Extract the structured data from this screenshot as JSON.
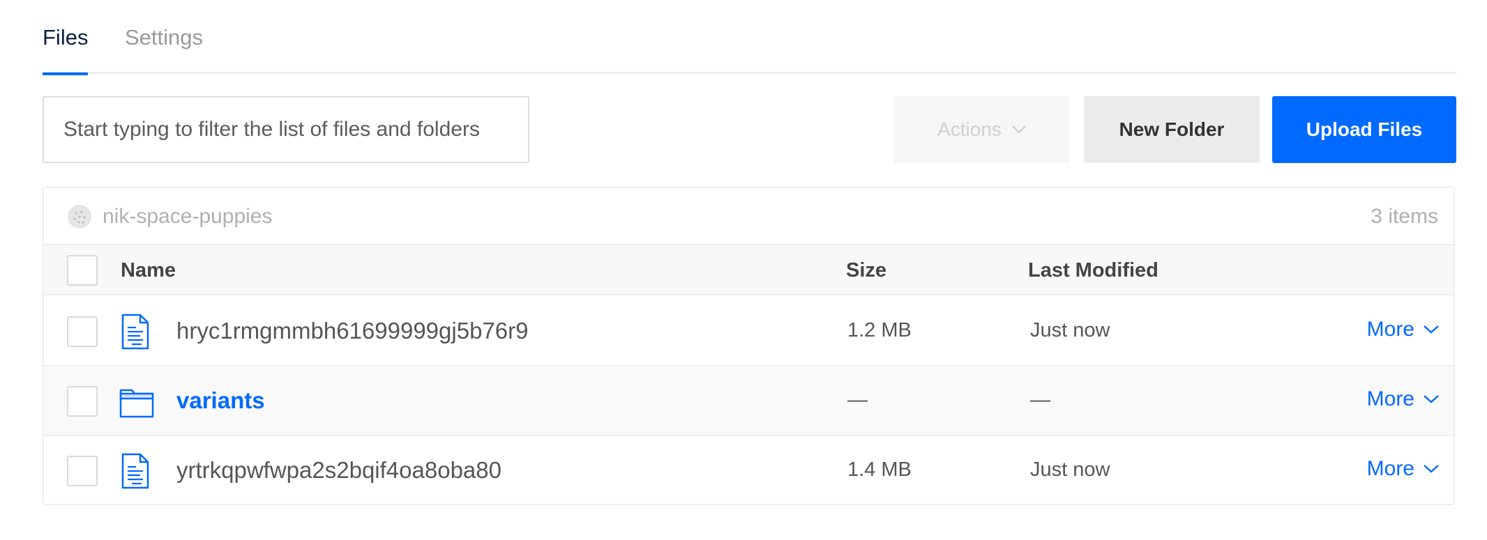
{
  "tabs": [
    {
      "label": "Files",
      "active": true
    },
    {
      "label": "Settings",
      "active": false
    }
  ],
  "toolbar": {
    "filter_placeholder": "Start typing to filter the list of files and folders",
    "actions_label": "Actions",
    "new_folder_label": "New Folder",
    "upload_label": "Upload Files"
  },
  "bucket": {
    "name": "nik-space-puppies",
    "count": "3 items"
  },
  "table": {
    "columns": [
      "Name",
      "Size",
      "Last Modified"
    ],
    "rows": [
      {
        "type": "file",
        "name": "hryc1rmgmmbh61699999gj5b76r9",
        "size": "1.2 MB",
        "modified": "Just now",
        "more": "More"
      },
      {
        "type": "folder",
        "name": "variants",
        "size": "—",
        "modified": "—",
        "more": "More"
      },
      {
        "type": "file",
        "name": "yrtrkqpwfwpa2s2bqif4oa8oba80",
        "size": "1.4 MB",
        "modified": "Just now",
        "more": "More"
      }
    ]
  },
  "colors": {
    "accent": "#0069ff",
    "active_tab_text": "#0a1f44"
  }
}
